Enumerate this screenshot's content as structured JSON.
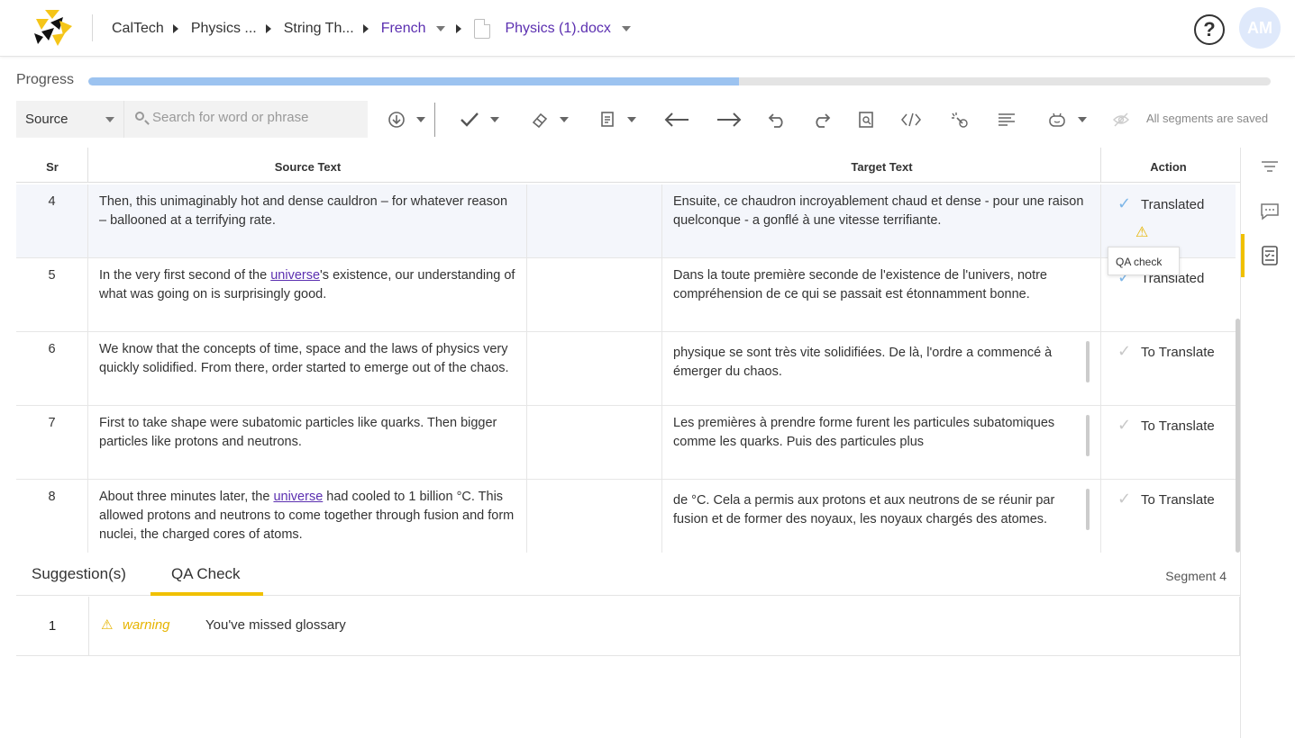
{
  "header": {
    "breadcrumbs": [
      "CalTech",
      "Physics ...",
      "String Th..."
    ],
    "language": "French",
    "file_name": "Physics (1).docx",
    "file_icon_label": "docx",
    "avatar_initials": "AM",
    "help_label": "?"
  },
  "progress": {
    "label": "Progress",
    "percent": 55
  },
  "toolbar": {
    "source_label": "Source",
    "search_placeholder": "Search for word or phrase",
    "saved_status": "All segments are saved"
  },
  "grid": {
    "headers": {
      "sr": "Sr",
      "source": "Source Text",
      "target": "Target Text",
      "action": "Action"
    },
    "rows": [
      {
        "sr": "4",
        "source_pre": "Then, this unimaginably hot and dense cauldron – for whatever reason – ballooned at a terrifying rate.",
        "gloss": "",
        "source_post": "",
        "target": "Ensuite, ce chaudron incroyablement chaud et dense - pour une raison quelconque - a gonflé à une vitesse terrifiante.",
        "status": "Translated"
      },
      {
        "sr": "5",
        "source_pre": "In the very first second of the ",
        "gloss": "universe",
        "source_post": "'s existence, our understanding of what was going on is surprisingly good.",
        "target": "Dans la toute première seconde de l'existence de l'univers, notre compréhension de ce qui se passait est étonnamment bonne.",
        "status": "Translated"
      },
      {
        "sr": "6",
        "source_pre": "We know that the concepts of time, space and the laws of physics very quickly solidified. From there, order started to emerge out of the chaos.",
        "gloss": "",
        "source_post": "",
        "target": "physique se sont très vite solidifiées. De là, l'ordre a commencé à émerger du chaos.",
        "status": "To Translate"
      },
      {
        "sr": "7",
        "source_pre": "First to take shape were subatomic particles like quarks. Then bigger particles like protons and neutrons.",
        "gloss": "",
        "source_post": "",
        "target": "Les premières à prendre forme furent les particules subatomiques comme les quarks. Puis des particules plus",
        "status": "To Translate"
      },
      {
        "sr": "8",
        "source_pre": "About three minutes later, the ",
        "gloss": "universe",
        "source_post": " had cooled to 1 billion °C. This allowed protons and neutrons to come together through fusion and form nuclei, the charged cores of atoms.",
        "target": "de °C. Cela a permis aux protons et aux neutrons de se réunir par fusion et de former des noyaux, les noyaux chargés des atomes.",
        "status": "To Translate"
      }
    ]
  },
  "tooltip": "QA check",
  "bottom": {
    "tabs": [
      "Suggestion(s)",
      "QA Check"
    ],
    "segment_label": "Segment 4",
    "qa_items": [
      {
        "num": "1",
        "level": "warning",
        "message": "You've missed glossary"
      }
    ]
  },
  "colors": {
    "accent": "#5b2fb0",
    "tab_underline": "#f0c000",
    "progress_fill": "#9cc3f0",
    "warning": "#e6b400"
  }
}
